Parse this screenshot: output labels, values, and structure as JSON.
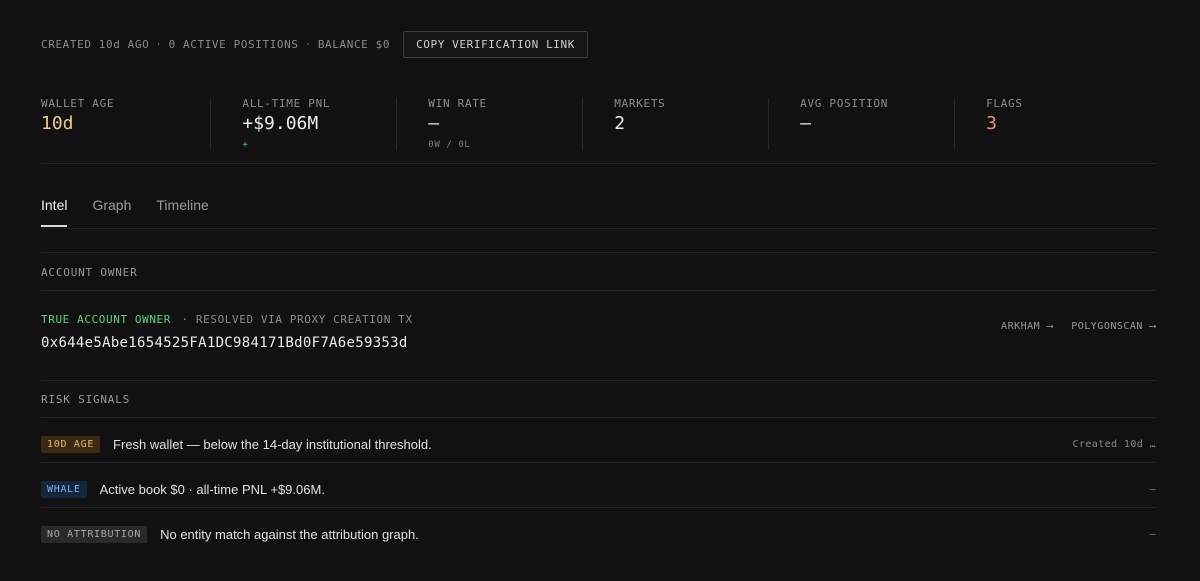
{
  "header": {
    "created": "CREATED 10d AGO",
    "positions": "0 ACTIVE POSITIONS",
    "balance": "BALANCE $0",
    "separator": "·",
    "copy_button": "COPY VERIFICATION LINK"
  },
  "stats": [
    {
      "label": "WALLET AGE",
      "value": "10d",
      "sub": "",
      "color": "#f3c98b"
    },
    {
      "label": "ALL-TIME PNL",
      "value": "+$9.06M",
      "sub": "+",
      "color": "#ececec",
      "sub_color": "#4ad36a"
    },
    {
      "label": "WIN RATE",
      "value": "—",
      "sub": "0W / 0L",
      "color": "#ececec"
    },
    {
      "label": "MARKETS",
      "value": "2",
      "sub": "",
      "color": "#ececec"
    },
    {
      "label": "AVG POSITION",
      "value": "—",
      "sub": "",
      "color": "#ececec"
    },
    {
      "label": "FLAGS",
      "value": "3",
      "sub": "",
      "color": "#f08a86"
    }
  ],
  "tabs": [
    {
      "label": "Intel",
      "active": true
    },
    {
      "label": "Graph",
      "active": false
    },
    {
      "label": "Timeline",
      "active": false
    }
  ],
  "account_owner": {
    "title": "ACCOUNT OWNER",
    "tag": "TRUE ACCOUNT OWNER",
    "tag_color": "#5fd37a",
    "resolved": "· RESOLVED VIA PROXY CREATION TX",
    "address": "0x644e5Abe1654525FA1DC984171Bd0F7A6e59353d",
    "links": [
      "ARKHAM ⟶",
      "POLYGONSCAN ⟶"
    ]
  },
  "risk_signals": {
    "title": "RISK SIGNALS",
    "items": [
      {
        "badge": "10D AGE",
        "text": "Fresh wallet — below the 14-day institutional threshold.",
        "right": "Created 10d …",
        "badge_bg": "#3a2a14",
        "badge_fg": "#f0b46a"
      },
      {
        "badge": "WHALE",
        "text": "Active book $0 · all-time PNL +$9.06M.",
        "right": "–",
        "badge_bg": "#14263d",
        "badge_fg": "#7fb2f0"
      },
      {
        "badge": "NO ATTRIBUTION",
        "text": "No entity match against the attribution graph.",
        "right": "–",
        "badge_bg": "#2a2a2a",
        "badge_fg": "#a8a8a8"
      }
    ]
  }
}
